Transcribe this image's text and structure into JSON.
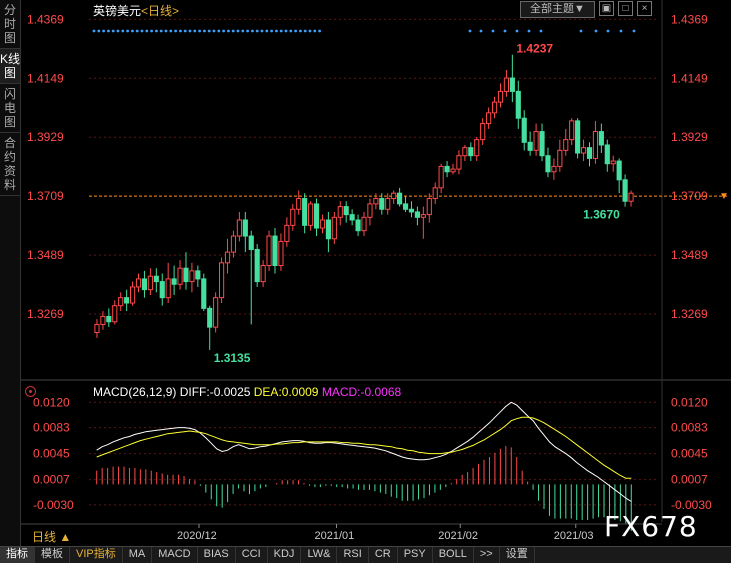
{
  "sidebar": {
    "tabs": [
      "分时图",
      "K线图",
      "闪电图",
      "合约资料"
    ],
    "active": 1
  },
  "header": {
    "symbol": "英镑美元",
    "period": "<日线>",
    "theme_button": "全部主题▼"
  },
  "window_icons": [
    "chart-view-icon",
    "restore-icon",
    "close-icon"
  ],
  "colors": {
    "up": "#ff4a4a",
    "down": "#45e0a0",
    "diff": "#ffffff",
    "dea": "#ffff33",
    "macd": "#ff33ff",
    "price_axis": "#ff4a4a",
    "grid": "#5a1515"
  },
  "macd_legend": {
    "name": "MACD(26,12,9)",
    "diff": "DIFF:-0.0025",
    "dea": "DEA:0.0009",
    "macd": "MACD:-0.0068"
  },
  "period_label": "日线 ▲",
  "watermark": "FX678",
  "bottom_bar": [
    "指标",
    "模板",
    "VIP指标",
    "MA",
    "MACD",
    "BIAS",
    "CCI",
    "KDJ",
    "LW&",
    "RSI",
    "CR",
    "PSY",
    "BOLL",
    ">>",
    "设置"
  ],
  "chart_data": [
    {
      "type": "candlestick",
      "title": "英镑美元<日线>",
      "y_ticks": [
        "1.4369",
        "1.4149",
        "1.3929",
        "1.3709",
        "1.3489",
        "1.3269"
      ],
      "ylim": [
        1.3045,
        1.4389
      ],
      "current_price_line": 1.3709,
      "high_label": "1.4237",
      "low_label": "1.3135",
      "recent_low_label": "1.3670",
      "x_ticks": [
        "2020/12",
        "2021/01",
        "2021/02",
        "2021/03"
      ],
      "candles": [
        [
          1.32,
          1.323,
          1.318,
          1.325
        ],
        [
          1.323,
          1.326,
          1.321,
          1.328
        ],
        [
          1.326,
          1.324,
          1.322,
          1.329
        ],
        [
          1.324,
          1.33,
          1.323,
          1.332
        ],
        [
          1.33,
          1.333,
          1.328,
          1.335
        ],
        [
          1.333,
          1.331,
          1.328,
          1.336
        ],
        [
          1.331,
          1.337,
          1.33,
          1.339
        ],
        [
          1.337,
          1.34,
          1.335,
          1.342
        ],
        [
          1.34,
          1.336,
          1.333,
          1.343
        ],
        [
          1.336,
          1.341,
          1.334,
          1.344
        ],
        [
          1.341,
          1.339,
          1.335,
          1.344
        ],
        [
          1.339,
          1.333,
          1.33,
          1.342
        ],
        [
          1.333,
          1.34,
          1.331,
          1.346
        ],
        [
          1.34,
          1.338,
          1.334,
          1.345
        ],
        [
          1.338,
          1.344,
          1.336,
          1.347
        ],
        [
          1.344,
          1.339,
          1.336,
          1.35
        ],
        [
          1.339,
          1.343,
          1.335,
          1.346
        ],
        [
          1.343,
          1.34,
          1.337,
          1.345
        ],
        [
          1.34,
          1.329,
          1.328,
          1.342
        ],
        [
          1.329,
          1.322,
          1.3135,
          1.33
        ],
        [
          1.322,
          1.333,
          1.32,
          1.335
        ],
        [
          1.333,
          1.346,
          1.331,
          1.348
        ],
        [
          1.346,
          1.35,
          1.342,
          1.355
        ],
        [
          1.35,
          1.356,
          1.348,
          1.358
        ],
        [
          1.356,
          1.362,
          1.354,
          1.365
        ],
        [
          1.362,
          1.356,
          1.35,
          1.365
        ],
        [
          1.356,
          1.351,
          1.323,
          1.358
        ],
        [
          1.351,
          1.339,
          1.337,
          1.353
        ],
        [
          1.339,
          1.345,
          1.337,
          1.347
        ],
        [
          1.345,
          1.356,
          1.343,
          1.358
        ],
        [
          1.356,
          1.345,
          1.342,
          1.359
        ],
        [
          1.345,
          1.354,
          1.343,
          1.357
        ],
        [
          1.354,
          1.36,
          1.352,
          1.363
        ],
        [
          1.36,
          1.366,
          1.358,
          1.368
        ],
        [
          1.366,
          1.37,
          1.364,
          1.373
        ],
        [
          1.37,
          1.36,
          1.357,
          1.372
        ],
        [
          1.36,
          1.368,
          1.358,
          1.369
        ],
        [
          1.368,
          1.359,
          1.356,
          1.37
        ],
        [
          1.359,
          1.362,
          1.357,
          1.364
        ],
        [
          1.362,
          1.355,
          1.35,
          1.365
        ],
        [
          1.355,
          1.363,
          1.353,
          1.365
        ],
        [
          1.363,
          1.367,
          1.36,
          1.369
        ],
        [
          1.367,
          1.364,
          1.361,
          1.369
        ],
        [
          1.364,
          1.362,
          1.36,
          1.366
        ],
        [
          1.362,
          1.358,
          1.356,
          1.364
        ],
        [
          1.358,
          1.363,
          1.356,
          1.365
        ],
        [
          1.363,
          1.368,
          1.36,
          1.37
        ],
        [
          1.368,
          1.37,
          1.366,
          1.372
        ],
        [
          1.37,
          1.366,
          1.364,
          1.372
        ],
        [
          1.366,
          1.37,
          1.364,
          1.372
        ],
        [
          1.37,
          1.372,
          1.368,
          1.373
        ],
        [
          1.372,
          1.368,
          1.367,
          1.374
        ],
        [
          1.368,
          1.366,
          1.365,
          1.371
        ],
        [
          1.366,
          1.365,
          1.363,
          1.369
        ],
        [
          1.365,
          1.363,
          1.36,
          1.367
        ],
        [
          1.363,
          1.364,
          1.355,
          1.367
        ],
        [
          1.364,
          1.37,
          1.361,
          1.372
        ],
        [
          1.37,
          1.374,
          1.368,
          1.376
        ],
        [
          1.374,
          1.382,
          1.372,
          1.383
        ],
        [
          1.382,
          1.38,
          1.378,
          1.384
        ],
        [
          1.38,
          1.381,
          1.379,
          1.383
        ],
        [
          1.381,
          1.386,
          1.379,
          1.388
        ],
        [
          1.386,
          1.389,
          1.384,
          1.39
        ],
        [
          1.389,
          1.386,
          1.384,
          1.391
        ],
        [
          1.386,
          1.392,
          1.384,
          1.393
        ],
        [
          1.392,
          1.398,
          1.39,
          1.4
        ],
        [
          1.398,
          1.402,
          1.396,
          1.404
        ],
        [
          1.402,
          1.406,
          1.4,
          1.408
        ],
        [
          1.406,
          1.41,
          1.404,
          1.413
        ],
        [
          1.41,
          1.415,
          1.408,
          1.418
        ],
        [
          1.415,
          1.41,
          1.406,
          1.4237
        ],
        [
          1.41,
          1.4,
          1.396,
          1.414
        ],
        [
          1.4,
          1.391,
          1.388,
          1.403
        ],
        [
          1.391,
          1.388,
          1.386,
          1.395
        ],
        [
          1.388,
          1.395,
          1.386,
          1.398
        ],
        [
          1.395,
          1.386,
          1.384,
          1.398
        ],
        [
          1.386,
          1.38,
          1.378,
          1.389
        ],
        [
          1.38,
          1.382,
          1.377,
          1.385
        ],
        [
          1.382,
          1.388,
          1.38,
          1.392
        ],
        [
          1.388,
          1.392,
          1.386,
          1.396
        ],
        [
          1.392,
          1.399,
          1.39,
          1.4
        ],
        [
          1.399,
          1.387,
          1.385,
          1.4
        ],
        [
          1.387,
          1.389,
          1.384,
          1.392
        ],
        [
          1.389,
          1.385,
          1.382,
          1.391
        ],
        [
          1.385,
          1.395,
          1.383,
          1.399
        ],
        [
          1.395,
          1.39,
          1.387,
          1.398
        ],
        [
          1.39,
          1.383,
          1.38,
          1.392
        ],
        [
          1.383,
          1.384,
          1.38,
          1.386
        ],
        [
          1.384,
          1.377,
          1.372,
          1.385
        ],
        [
          1.377,
          1.369,
          1.367,
          1.379
        ],
        [
          1.369,
          1.372,
          1.367,
          1.373
        ]
      ]
    },
    {
      "type": "line+bar",
      "title": "MACD(26,12,9)",
      "y_ticks": [
        "0.0120",
        "0.0083",
        "0.0045",
        "0.0007",
        "-0.0030"
      ],
      "ylim": [
        -0.0055,
        0.0135
      ],
      "series": [
        {
          "name": "DIFF",
          "values": [
            0.005,
            0.0055,
            0.0058,
            0.0062,
            0.0065,
            0.0068,
            0.007,
            0.0073,
            0.0075,
            0.0077,
            0.0078,
            0.0079,
            0.008,
            0.0081,
            0.0082,
            0.0083,
            0.0083,
            0.0082,
            0.008,
            0.0075,
            0.0068,
            0.006,
            0.0052,
            0.0048,
            0.005,
            0.0055,
            0.0058,
            0.0055,
            0.0052,
            0.0053,
            0.0055,
            0.0056,
            0.0058,
            0.006,
            0.0062,
            0.0063,
            0.0064,
            0.0064,
            0.0063,
            0.0061,
            0.006,
            0.006,
            0.0061,
            0.0061,
            0.006,
            0.0059,
            0.0058,
            0.0057,
            0.0056,
            0.0055,
            0.0054,
            0.0053,
            0.0051,
            0.0049,
            0.0046,
            0.0043,
            0.004,
            0.0038,
            0.0037,
            0.0036,
            0.0036,
            0.0037,
            0.0039,
            0.0041,
            0.0044,
            0.0048,
            0.0053,
            0.0058,
            0.0063,
            0.0069,
            0.0076,
            0.0083,
            0.009,
            0.0098,
            0.0106,
            0.0114,
            0.012,
            0.0116,
            0.0108,
            0.01,
            0.0093,
            0.0082,
            0.0072,
            0.0062,
            0.0055,
            0.005,
            0.0045,
            0.0039,
            0.0032,
            0.0026,
            0.002,
            0.0015,
            0.001,
            0.0004,
            -0.0002,
            -0.0008,
            -0.0014,
            -0.002,
            -0.0025
          ]
        },
        {
          "name": "DEA",
          "values": [
            0.004,
            0.0043,
            0.0046,
            0.0049,
            0.0052,
            0.0055,
            0.0058,
            0.0061,
            0.0064,
            0.0066,
            0.0068,
            0.007,
            0.0072,
            0.0074,
            0.0075,
            0.0076,
            0.0077,
            0.0078,
            0.0077,
            0.0076,
            0.0074,
            0.0071,
            0.0068,
            0.0065,
            0.0063,
            0.0062,
            0.0061,
            0.006,
            0.0059,
            0.0058,
            0.0058,
            0.0058,
            0.0058,
            0.0059,
            0.0059,
            0.006,
            0.0061,
            0.0061,
            0.0062,
            0.0062,
            0.0062,
            0.0062,
            0.0062,
            0.0062,
            0.0062,
            0.0061,
            0.0061,
            0.006,
            0.006,
            0.0059,
            0.0058,
            0.0058,
            0.0057,
            0.0056,
            0.0055,
            0.0053,
            0.0052,
            0.005,
            0.0049,
            0.0047,
            0.0046,
            0.0045,
            0.0045,
            0.0045,
            0.0046,
            0.0047,
            0.0049,
            0.0051,
            0.0054,
            0.0057,
            0.0061,
            0.0065,
            0.007,
            0.0075,
            0.008,
            0.0086,
            0.0093,
            0.0096,
            0.0098,
            0.0098,
            0.0097,
            0.0094,
            0.009,
            0.0085,
            0.008,
            0.0075,
            0.007,
            0.0064,
            0.0058,
            0.0052,
            0.0046,
            0.004,
            0.0034,
            0.0028,
            0.0023,
            0.0018,
            0.0013,
            0.0009,
            0.0009
          ]
        },
        {
          "name": "MACD",
          "type": "bar",
          "values": [
            0.002,
            0.0024,
            0.0024,
            0.0026,
            0.0026,
            0.0026,
            0.0024,
            0.0024,
            0.0022,
            0.0022,
            0.002,
            0.0018,
            0.0016,
            0.0014,
            0.0014,
            0.0014,
            0.0012,
            0.0008,
            0.0006,
            -0.0002,
            -0.0012,
            -0.0022,
            -0.0032,
            -0.0034,
            -0.0026,
            -0.0014,
            -0.0006,
            -0.001,
            -0.0014,
            -0.001,
            -0.0006,
            -0.0004,
            0.0,
            0.0002,
            0.0006,
            0.0006,
            0.0006,
            0.0006,
            0.0002,
            -0.0002,
            -0.0004,
            -0.0004,
            -0.0002,
            -0.0002,
            -0.0004,
            -0.0004,
            -0.0006,
            -0.0006,
            -0.0008,
            -0.0008,
            -0.0008,
            -0.001,
            -0.0012,
            -0.0014,
            -0.0018,
            -0.002,
            -0.0024,
            -0.0024,
            -0.0024,
            -0.0022,
            -0.002,
            -0.0016,
            -0.0012,
            -0.0008,
            -0.0004,
            0.0002,
            0.0008,
            0.0014,
            0.0018,
            0.0024,
            0.003,
            0.0036,
            0.004,
            0.0046,
            0.0052,
            0.0056,
            0.0054,
            0.004,
            0.002,
            0.0004,
            -0.0008,
            -0.0024,
            -0.0036,
            -0.0046,
            -0.005,
            -0.005,
            -0.005,
            -0.005,
            -0.0052,
            -0.0052,
            -0.0052,
            -0.005,
            -0.0048,
            -0.0048,
            -0.005,
            -0.0052,
            -0.0054,
            -0.0058,
            -0.0068
          ]
        }
      ]
    }
  ]
}
